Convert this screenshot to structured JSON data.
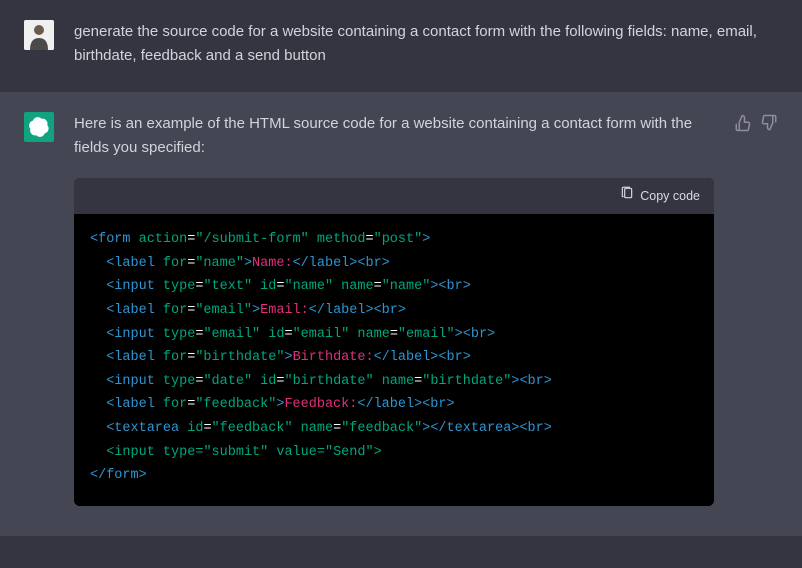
{
  "user": {
    "message": "generate the source code for a website containing a contact form with the following fields: name, email, birthdate, feedback and a send button"
  },
  "assistant": {
    "intro": "Here is an example of the HTML source code for a website containing a contact form with the fields you specified:",
    "copy_label": "Copy code",
    "code": {
      "form_open_1": "<form",
      "form_open_attr1": " action",
      "form_open_eq1": "=",
      "form_open_val1": "\"/submit-form\"",
      "form_open_attr2": " method",
      "form_open_eq2": "=",
      "form_open_val2": "\"post\"",
      "form_open_close": ">",
      "label_name_open": "  <label",
      "label_name_for": " for",
      "label_name_eq": "=",
      "label_name_val": "\"name\"",
      "label_name_close": ">",
      "label_name_text": "Name:",
      "label_name_end": "</label>",
      "br1": "<br>",
      "input_name_open": "  <input",
      "input_name_type": " type",
      "input_name_type_eq": "=",
      "input_name_type_val": "\"text\"",
      "input_name_id": " id",
      "input_name_id_eq": "=",
      "input_name_id_val": "\"name\"",
      "input_name_name": " name",
      "input_name_name_eq": "=",
      "input_name_name_val": "\"name\"",
      "input_name_close": ">",
      "br2": "<br>",
      "label_email_open": "  <label",
      "label_email_for": " for",
      "label_email_eq": "=",
      "label_email_val": "\"email\"",
      "label_email_close": ">",
      "label_email_text": "Email:",
      "label_email_end": "</label>",
      "br3": "<br>",
      "input_email_open": "  <input",
      "input_email_type": " type",
      "input_email_type_eq": "=",
      "input_email_type_val": "\"email\"",
      "input_email_id": " id",
      "input_email_id_eq": "=",
      "input_email_id_val": "\"email\"",
      "input_email_name": " name",
      "input_email_name_eq": "=",
      "input_email_name_val": "\"email\"",
      "input_email_close": ">",
      "br4": "<br>",
      "label_bd_open": "  <label",
      "label_bd_for": " for",
      "label_bd_eq": "=",
      "label_bd_val": "\"birthdate\"",
      "label_bd_close": ">",
      "label_bd_text": "Birthdate:",
      "label_bd_end": "</label>",
      "br5": "<br>",
      "input_bd_open": "  <input",
      "input_bd_type": " type",
      "input_bd_type_eq": "=",
      "input_bd_type_val": "\"date\"",
      "input_bd_id": " id",
      "input_bd_id_eq": "=",
      "input_bd_id_val": "\"birthdate\"",
      "input_bd_name": " name",
      "input_bd_name_eq": "=",
      "input_bd_name_val": "\"birthdate\"",
      "input_bd_close": ">",
      "br6": "<br>",
      "label_fb_open": "  <label",
      "label_fb_for": " for",
      "label_fb_eq": "=",
      "label_fb_val": "\"feedback\"",
      "label_fb_close": ">",
      "label_fb_text": "Feedback:",
      "label_fb_end": "</label>",
      "br7": "<br>",
      "textarea_open": "  <textarea",
      "textarea_id": " id",
      "textarea_id_eq": "=",
      "textarea_id_val": "\"feedback\"",
      "textarea_name": " name",
      "textarea_name_eq": "=",
      "textarea_name_val": "\"feedback\"",
      "textarea_close": ">",
      "textarea_end": "</textarea>",
      "br8": "<br>",
      "submit_open": "  <input",
      "submit_type": " type",
      "submit_type_eq": "=",
      "submit_type_val": "\"submit\"",
      "submit_value": " value",
      "submit_value_eq": "=",
      "submit_value_val": "\"Send\"",
      "submit_close": ">",
      "form_end": "</form>"
    }
  }
}
